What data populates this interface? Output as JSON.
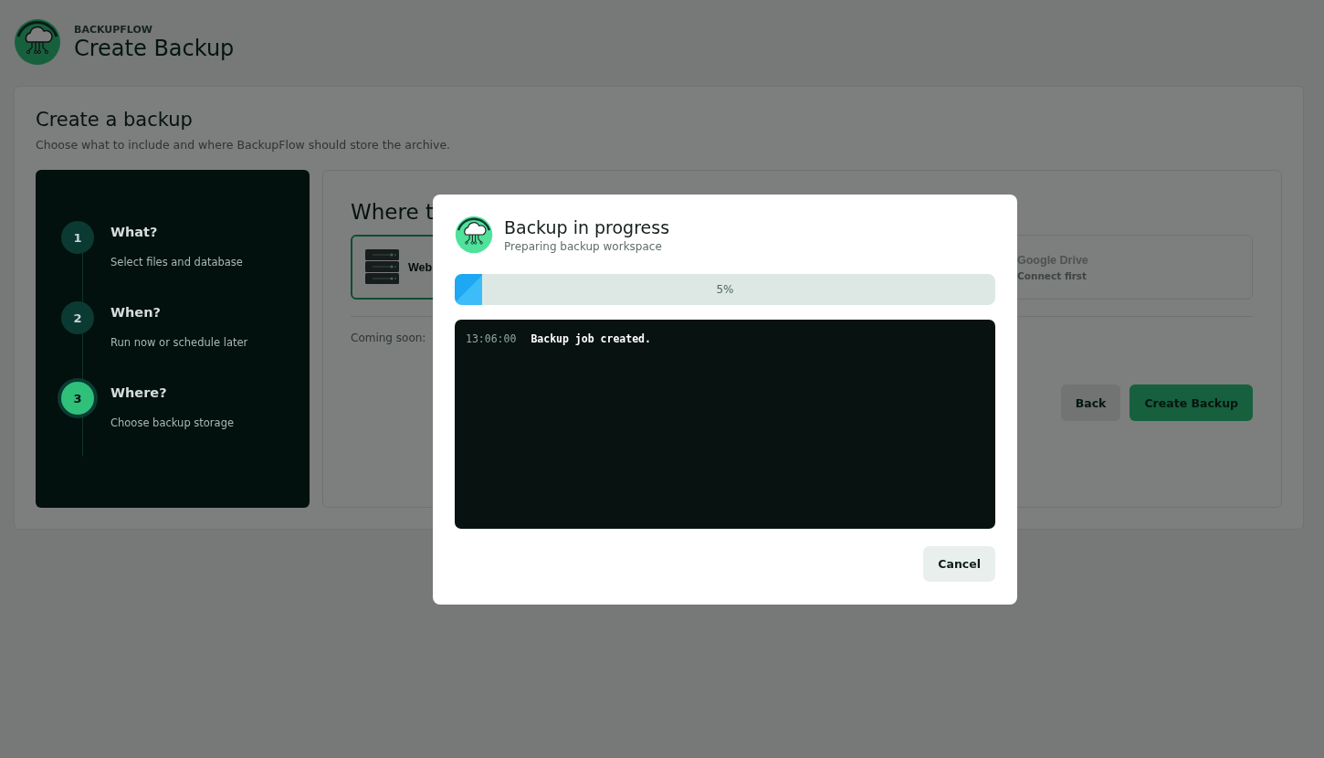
{
  "app": {
    "brand": "BACKUPFLOW",
    "title": "Create Backup"
  },
  "card": {
    "title": "Create a backup",
    "subtitle": "Choose what to include and where BackupFlow should store the archive."
  },
  "steps": [
    {
      "number": "1",
      "title": "What?",
      "description": "Select files and database",
      "selected": false
    },
    {
      "number": "2",
      "title": "When?",
      "description": "Run now or schedule later",
      "selected": false
    },
    {
      "number": "3",
      "title": "Where?",
      "description": "Choose backup storage",
      "selected": true
    }
  ],
  "storage": {
    "heading": "Where t",
    "options": [
      {
        "label": "Web",
        "kind": "server",
        "selected": true
      },
      {
        "label": "Google Drive",
        "note": "Connect first",
        "kind": "drive",
        "selected": false
      }
    ],
    "coming_soon": "Coming soon:"
  },
  "actions": [
    {
      "label": "Back",
      "kind": "secondary"
    },
    {
      "label": "Create Backup",
      "kind": "primary"
    }
  ],
  "modal": {
    "title": "Backup in progress",
    "subtitle": "Preparing backup workspace",
    "progress": {
      "level": 0.05,
      "label": "5%"
    },
    "log": [
      {
        "time": "13:06:00",
        "message": "Backup job created."
      }
    ],
    "buttons": [
      {
        "label": "Cancel"
      }
    ]
  }
}
